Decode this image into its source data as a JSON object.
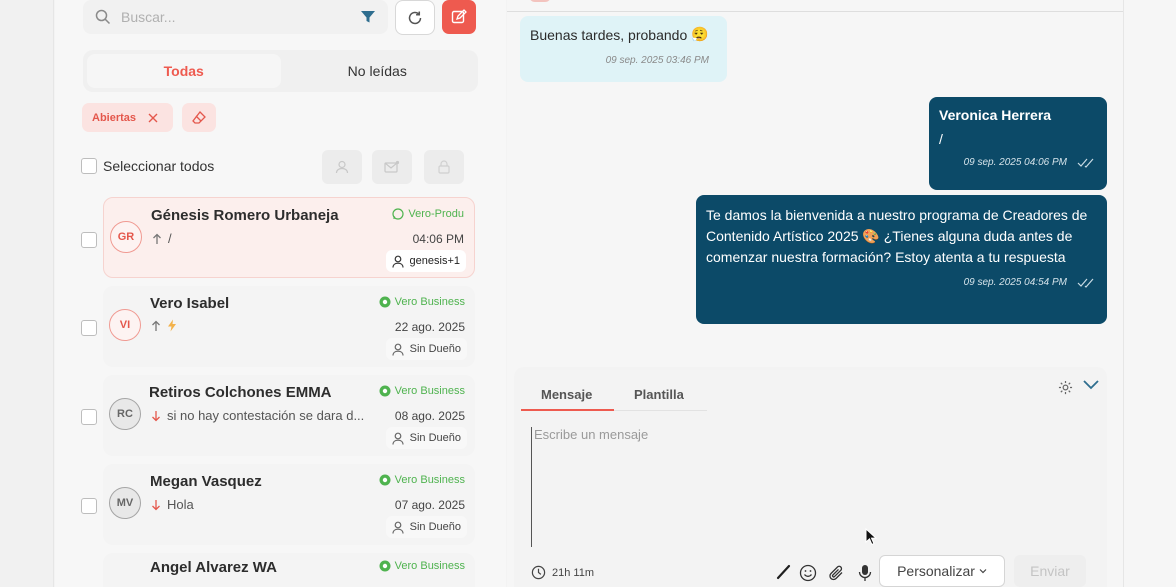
{
  "search": {
    "placeholder": "Buscar..."
  },
  "tabs": [
    {
      "label": "Todas"
    },
    {
      "label": "No leídas"
    }
  ],
  "filters": {
    "active_chip": "Abiertas"
  },
  "select_all_label": "Seleccionar todos",
  "conversations": [
    {
      "initials": "GR",
      "name": "Génesis Romero Urbaneja",
      "channel": "Vero-Produ",
      "preview": "/",
      "date": "04:06 PM",
      "owner": "genesis+1"
    },
    {
      "initials": "VI",
      "name": "Vero Isabel",
      "channel": "Vero Business",
      "preview": "",
      "date": "22 ago. 2025",
      "owner": "Sin Dueño"
    },
    {
      "initials": "RC",
      "name": "Retiros Colchones EMMA",
      "channel": "Vero Business",
      "preview": "si no hay contestación se dara d...",
      "date": "08 ago. 2025",
      "owner": "Sin Dueño"
    },
    {
      "initials": "MV",
      "name": "Megan Vasquez",
      "channel": "Vero Business",
      "preview": "Hola",
      "date": "07 ago. 2025",
      "owner": "Sin Dueño"
    },
    {
      "initials": "AA",
      "name": "Angel Alvarez WA",
      "channel": "Vero Business",
      "preview": "",
      "date": "",
      "owner": ""
    }
  ],
  "messages": {
    "incoming": {
      "text": "Buenas tardes, probando",
      "emoji": "😮‍💨",
      "time": "09 sep. 2025 03:46 PM"
    },
    "outgoing1": {
      "sender": "Veronica Herrera",
      "text": "/",
      "time": "09 sep. 2025 04:06 PM"
    },
    "outgoing2": {
      "text": "Te damos la bienvenida a nuestro programa de Creadores de Contenido Artístico 2025 🎨 ¿Tienes alguna duda antes de comenzar nuestra formación? Estoy atenta a tu respuesta",
      "time": "09 sep. 2025 04:54 PM"
    }
  },
  "composer": {
    "tab_message": "Mensaje",
    "tab_template": "Plantilla",
    "placeholder": "Escribe un mensaje",
    "timer": "21h 11m",
    "personalize_label": "Personalizar",
    "send_label": "Enviar"
  },
  "colors": {
    "accent": "#ee5a4f",
    "outgoing_bubble": "#0c4a68",
    "incoming_bubble": "#dff3f7",
    "channel_green": "#4fb34f"
  }
}
